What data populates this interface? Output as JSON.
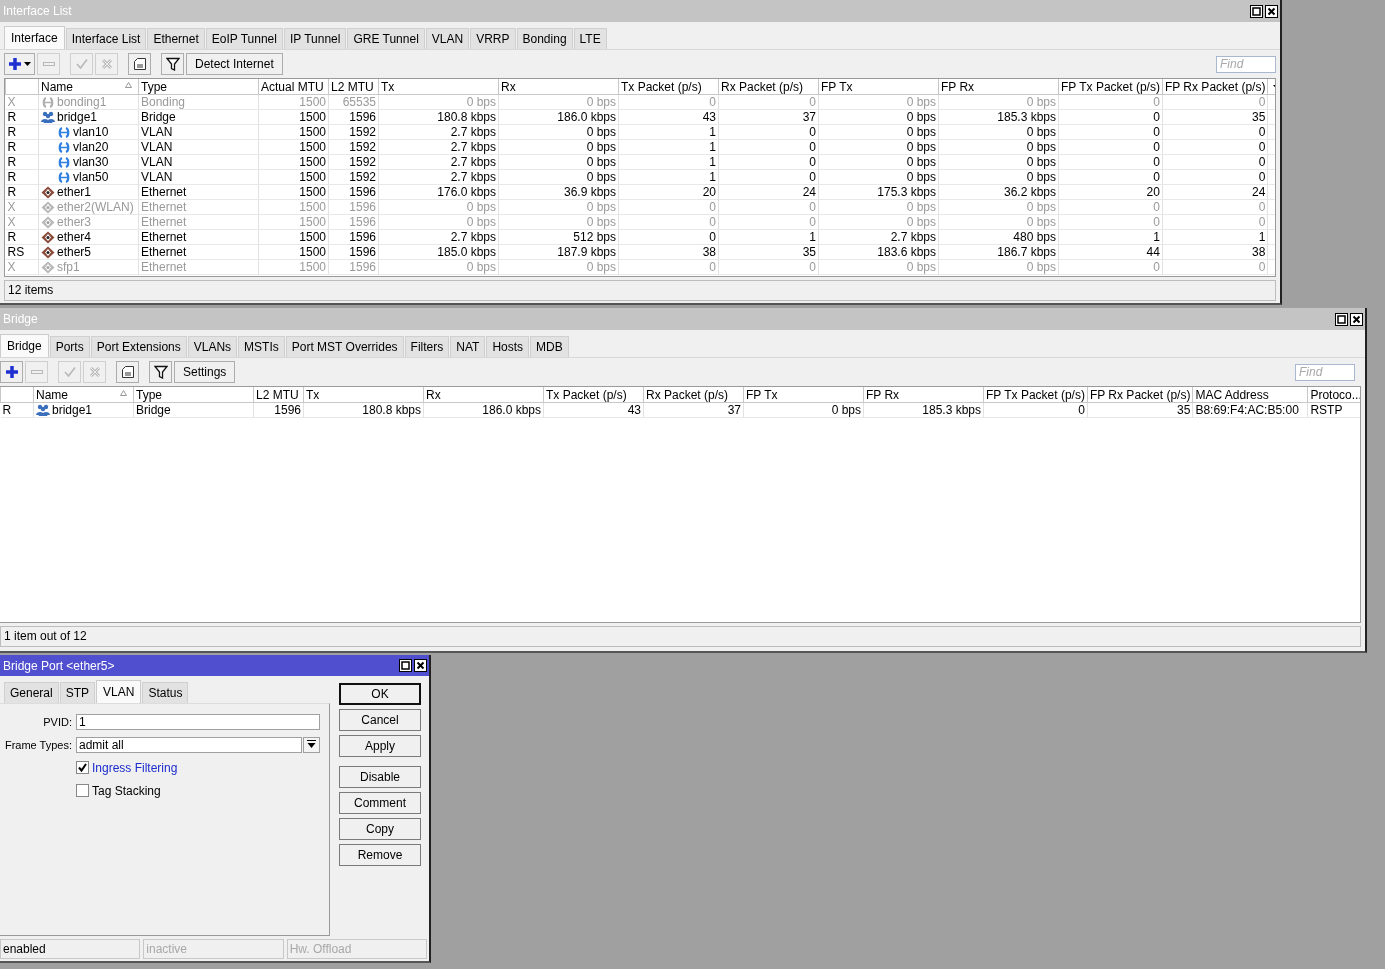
{
  "interface_window": {
    "title": "Interface List",
    "active": false,
    "tabs": [
      {
        "label": "Interface",
        "selected": true
      },
      {
        "label": "Interface List",
        "selected": false
      },
      {
        "label": "Ethernet",
        "selected": false
      },
      {
        "label": "EoIP Tunnel",
        "selected": false
      },
      {
        "label": "IP Tunnel",
        "selected": false
      },
      {
        "label": "GRE Tunnel",
        "selected": false
      },
      {
        "label": "VLAN",
        "selected": false
      },
      {
        "label": "VRRP",
        "selected": false
      },
      {
        "label": "Bonding",
        "selected": false
      },
      {
        "label": "LTE",
        "selected": false
      }
    ],
    "toolbar": [
      {
        "kind": "add",
        "menu": true,
        "disabled": false
      },
      {
        "kind": "remove",
        "menu": false,
        "disabled": true
      },
      {
        "kind": "enable",
        "menu": false,
        "disabled": true
      },
      {
        "kind": "disable",
        "menu": false,
        "disabled": true
      },
      {
        "kind": "comment",
        "menu": false,
        "disabled": false
      },
      {
        "kind": "filter",
        "menu": false,
        "disabled": false
      }
    ],
    "action_button": "Detect Internet",
    "find_placeholder": "Find",
    "columns": [
      {
        "label": "Name",
        "kind": "text",
        "sorted": true
      },
      {
        "label": "Type",
        "kind": "text",
        "sorted": false
      },
      {
        "label": "Actual MTU",
        "kind": "number",
        "sorted": false
      },
      {
        "label": "L2 MTU",
        "kind": "number",
        "sorted": false
      },
      {
        "label": "Tx",
        "kind": "number",
        "sorted": false
      },
      {
        "label": "Rx",
        "kind": "number",
        "sorted": false
      },
      {
        "label": "Tx Packet (p/s)",
        "kind": "number",
        "sorted": false
      },
      {
        "label": "Rx Packet (p/s)",
        "kind": "number",
        "sorted": false
      },
      {
        "label": "FP Tx",
        "kind": "number",
        "sorted": false
      },
      {
        "label": "FP Rx",
        "kind": "number",
        "sorted": false
      },
      {
        "label": "FP Tx Packet (p/s)",
        "kind": "number",
        "sorted": false
      },
      {
        "label": "FP Rx Packet (p/s)",
        "kind": "number",
        "sorted": false
      }
    ],
    "rows": [
      {
        "flag": "X",
        "kind": "bonding",
        "disabled": true,
        "cells": [
          "bonding1",
          "Bonding",
          "1500",
          "65535",
          "0 bps",
          "0 bps",
          "0",
          "0",
          "0 bps",
          "0 bps",
          "0",
          "0"
        ]
      },
      {
        "flag": "R",
        "kind": "bridge",
        "disabled": false,
        "cells": [
          "bridge1",
          "Bridge",
          "1500",
          "1596",
          "180.8 kbps",
          "186.0 kbps",
          "43",
          "37",
          "0 bps",
          "185.3 kbps",
          "0",
          "35"
        ],
        "children": [
          {
            "flag": "R",
            "kind": "vlan",
            "disabled": false,
            "cells": [
              "vlan10",
              "VLAN",
              "1500",
              "1592",
              "2.7 kbps",
              "0 bps",
              "1",
              "0",
              "0 bps",
              "0 bps",
              "0",
              "0"
            ]
          },
          {
            "flag": "R",
            "kind": "vlan",
            "disabled": false,
            "cells": [
              "vlan20",
              "VLAN",
              "1500",
              "1592",
              "2.7 kbps",
              "0 bps",
              "1",
              "0",
              "0 bps",
              "0 bps",
              "0",
              "0"
            ]
          },
          {
            "flag": "R",
            "kind": "vlan",
            "disabled": false,
            "cells": [
              "vlan30",
              "VLAN",
              "1500",
              "1592",
              "2.7 kbps",
              "0 bps",
              "1",
              "0",
              "0 bps",
              "0 bps",
              "0",
              "0"
            ]
          },
          {
            "flag": "R",
            "kind": "vlan",
            "disabled": false,
            "cells": [
              "vlan50",
              "VLAN",
              "1500",
              "1592",
              "2.7 kbps",
              "0 bps",
              "1",
              "0",
              "0 bps",
              "0 bps",
              "0",
              "0"
            ]
          }
        ]
      },
      {
        "flag": "R",
        "kind": "ethernet",
        "disabled": false,
        "cells": [
          "ether1",
          "Ethernet",
          "1500",
          "1596",
          "176.0 kbps",
          "36.9 kbps",
          "20",
          "24",
          "175.3 kbps",
          "36.2 kbps",
          "20",
          "24"
        ]
      },
      {
        "flag": "X",
        "kind": "ethernet",
        "disabled": true,
        "cells": [
          "ether2(WLAN)",
          "Ethernet",
          "1500",
          "1596",
          "0 bps",
          "0 bps",
          "0",
          "0",
          "0 bps",
          "0 bps",
          "0",
          "0"
        ]
      },
      {
        "flag": "X",
        "kind": "ethernet",
        "disabled": true,
        "cells": [
          "ether3",
          "Ethernet",
          "1500",
          "1596",
          "0 bps",
          "0 bps",
          "0",
          "0",
          "0 bps",
          "0 bps",
          "0",
          "0"
        ]
      },
      {
        "flag": "R",
        "kind": "ethernet",
        "disabled": false,
        "cells": [
          "ether4",
          "Ethernet",
          "1500",
          "1596",
          "2.7 kbps",
          "512 bps",
          "0",
          "1",
          "2.7 kbps",
          "480 bps",
          "1",
          "1"
        ]
      },
      {
        "flag": "RS",
        "kind": "ethernet",
        "disabled": false,
        "cells": [
          "ether5",
          "Ethernet",
          "1500",
          "1596",
          "185.0 kbps",
          "187.9 kbps",
          "38",
          "35",
          "183.6 kbps",
          "186.7 kbps",
          "44",
          "38"
        ]
      },
      {
        "flag": "X",
        "kind": "ethernet",
        "disabled": true,
        "cells": [
          "sfp1",
          "Ethernet",
          "1500",
          "1596",
          "0 bps",
          "0 bps",
          "0",
          "0",
          "0 bps",
          "0 bps",
          "0",
          "0"
        ]
      }
    ],
    "status": "12 items"
  },
  "bridge_window": {
    "title": "Bridge",
    "active": false,
    "tabs": [
      {
        "label": "Bridge",
        "selected": true
      },
      {
        "label": "Ports",
        "selected": false
      },
      {
        "label": "Port Extensions",
        "selected": false
      },
      {
        "label": "VLANs",
        "selected": false
      },
      {
        "label": "MSTIs",
        "selected": false
      },
      {
        "label": "Port MST Overrides",
        "selected": false
      },
      {
        "label": "Filters",
        "selected": false
      },
      {
        "label": "NAT",
        "selected": false
      },
      {
        "label": "Hosts",
        "selected": false
      },
      {
        "label": "MDB",
        "selected": false
      }
    ],
    "toolbar": [
      {
        "kind": "add",
        "menu": false,
        "disabled": false
      },
      {
        "kind": "remove",
        "menu": false,
        "disabled": true
      },
      {
        "kind": "enable",
        "menu": false,
        "disabled": true
      },
      {
        "kind": "disable",
        "menu": false,
        "disabled": true
      },
      {
        "kind": "comment",
        "menu": false,
        "disabled": false
      },
      {
        "kind": "filter",
        "menu": false,
        "disabled": false
      }
    ],
    "action_button": "Settings",
    "find_placeholder": "Find",
    "columns": [
      {
        "label": "Name",
        "kind": "text",
        "sorted": true
      },
      {
        "label": "Type",
        "kind": "text",
        "sorted": false
      },
      {
        "label": "L2 MTU",
        "kind": "number",
        "sorted": false
      },
      {
        "label": "Tx",
        "kind": "number",
        "sorted": false
      },
      {
        "label": "Rx",
        "kind": "number",
        "sorted": false
      },
      {
        "label": "Tx Packet (p/s)",
        "kind": "number",
        "sorted": false
      },
      {
        "label": "Rx Packet (p/s)",
        "kind": "number",
        "sorted": false
      },
      {
        "label": "FP Tx",
        "kind": "number",
        "sorted": false
      },
      {
        "label": "FP Rx",
        "kind": "number",
        "sorted": false
      },
      {
        "label": "FP Tx Packet (p/s)",
        "kind": "number",
        "sorted": false
      },
      {
        "label": "FP Rx Packet (p/s)",
        "kind": "number",
        "sorted": false
      },
      {
        "label": "MAC Address",
        "kind": "text",
        "sorted": false
      },
      {
        "label": "Protoco...",
        "kind": "text",
        "sorted": false
      }
    ],
    "rows": [
      {
        "flag": "R",
        "kind": "bridge",
        "disabled": false,
        "cells": [
          "bridge1",
          "Bridge",
          "1596",
          "180.8 kbps",
          "186.0 kbps",
          "43",
          "37",
          "0 bps",
          "185.3 kbps",
          "0",
          "35",
          "B8:69:F4:AC:B5:00",
          "RSTP"
        ]
      }
    ],
    "status": "1 item out of 12"
  },
  "bridge_port_dialog": {
    "title": "Bridge Port <ether5>",
    "active": true,
    "tabs": [
      {
        "label": "General",
        "selected": false
      },
      {
        "label": "STP",
        "selected": false
      },
      {
        "label": "VLAN",
        "selected": true
      },
      {
        "label": "Status",
        "selected": false
      }
    ],
    "fields": [
      {
        "label": "PVID:",
        "value": "1",
        "kind": "text"
      },
      {
        "label": "Frame Types:",
        "value": "admit all",
        "kind": "dropdown"
      }
    ],
    "checkboxes": [
      {
        "label": "Ingress Filtering",
        "checked": true,
        "highlighted": true
      },
      {
        "label": "Tag Stacking",
        "checked": false,
        "highlighted": false
      }
    ],
    "button_groups": [
      [
        {
          "label": "OK",
          "default": true
        },
        {
          "label": "Cancel",
          "default": false
        },
        {
          "label": "Apply",
          "default": false
        }
      ],
      [
        {
          "label": "Disable",
          "default": false
        },
        {
          "label": "Comment",
          "default": false
        },
        {
          "label": "Copy",
          "default": false
        },
        {
          "label": "Remove",
          "default": false
        }
      ]
    ],
    "status": [
      {
        "text": "enabled",
        "disabled": false
      },
      {
        "text": "inactive",
        "disabled": true
      },
      {
        "text": "Hw. Offload",
        "disabled": true
      }
    ]
  }
}
